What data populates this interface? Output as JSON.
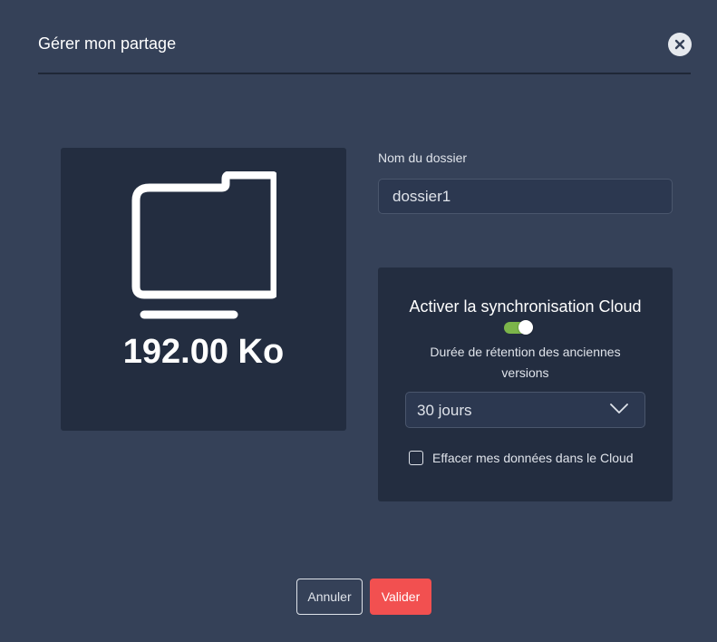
{
  "dialog": {
    "title": "Gérer mon partage",
    "close_icon": "close-icon"
  },
  "preview": {
    "icon": "folder-icon",
    "size": "192.00 Ko"
  },
  "folder_name": {
    "label": "Nom du dossier",
    "value": "dossier1"
  },
  "cloud": {
    "sync_label": "Activer la synchronisation Cloud",
    "sync_enabled": true,
    "toggle_color": "#7cb54a",
    "retention_label": "Durée de rétention des anciennes versions",
    "retention_selected": "30 jours",
    "erase_label": "Effacer mes données dans le Cloud",
    "erase_checked": false
  },
  "actions": {
    "cancel_label": "Annuler",
    "submit_label": "Valider",
    "submit_color": "#f25050"
  }
}
